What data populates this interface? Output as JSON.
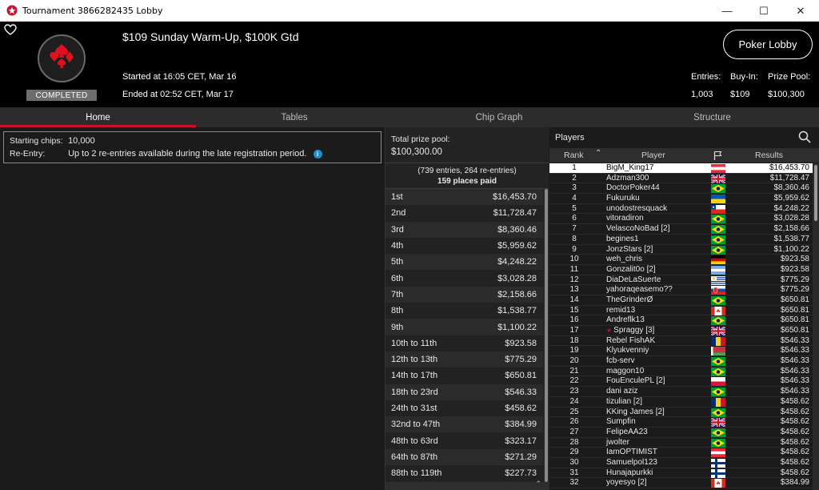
{
  "window": {
    "title": "Tournament 3866282435 Lobby",
    "minimize": "—",
    "maximize": "☐",
    "close": "✕"
  },
  "header": {
    "status_badge": "COMPLETED",
    "tournament_name": "$109 Sunday Warm-Up, $100K Gtd",
    "started": "Started at 16:05 CET, Mar 16",
    "ended": "Ended at 02:52 CET, Mar 17",
    "lobby_button": "Poker Lobby",
    "entries_label": "Entries:",
    "entries_value": "1,003",
    "buyin_label": "Buy-In:",
    "buyin_value": "$109",
    "prizepool_label": "Prize Pool:",
    "prizepool_value": "$100,300"
  },
  "tabs": [
    "Home",
    "Tables",
    "Chip Graph",
    "Structure"
  ],
  "info": {
    "starting_chips_label": "Starting chips:",
    "starting_chips_value": "10,000",
    "reentry_label": "Re-Entry:",
    "reentry_value": "Up to 2 re-entries available during the late registration period.",
    "info_icon": "i"
  },
  "prize": {
    "total_label": "Total prize pool:",
    "total_value": "$100,300.00",
    "entries_note": "(739 entries, 264 re-entries)",
    "places_paid": "159 places paid",
    "rows": [
      [
        "1st",
        "$16,453.70"
      ],
      [
        "2nd",
        "$11,728.47"
      ],
      [
        "3rd",
        "$8,360.46"
      ],
      [
        "4th",
        "$5,959.62"
      ],
      [
        "5th",
        "$4,248.22"
      ],
      [
        "6th",
        "$3,028.28"
      ],
      [
        "7th",
        "$2,158.66"
      ],
      [
        "8th",
        "$1,538.77"
      ],
      [
        "9th",
        "$1,100.22"
      ],
      [
        "10th to 11th",
        "$923.58"
      ],
      [
        "12th to 13th",
        "$775.29"
      ],
      [
        "14th to 17th",
        "$650.81"
      ],
      [
        "18th to 23rd",
        "$546.33"
      ],
      [
        "24th to 31st",
        "$458.62"
      ],
      [
        "32nd to 47th",
        "$384.99"
      ],
      [
        "48th to 63rd",
        "$323.17"
      ],
      [
        "64th to 87th",
        "$271.29"
      ],
      [
        "88th to 119th",
        "$227.73"
      ]
    ]
  },
  "players": {
    "title": "Players",
    "col_rank": "Rank",
    "col_player": "Player",
    "col_results": "Results",
    "rows": [
      [
        "1",
        "BigM_King17",
        "$16,453.70",
        "at"
      ],
      [
        "2",
        "Adzman300",
        "$11,728.47",
        "gb"
      ],
      [
        "3",
        "DoctorPoker44",
        "$8,360.46",
        "br"
      ],
      [
        "4",
        "Fukuruku",
        "$5,959.62",
        "ua"
      ],
      [
        "5",
        "unodostresquack",
        "$4,248.22",
        "cl"
      ],
      [
        "6",
        "vitoradiron",
        "$3,028.28",
        "br"
      ],
      [
        "7",
        "VelascoNoBad [2]",
        "$2,158.66",
        "br"
      ],
      [
        "8",
        "begines1",
        "$1,538.77",
        "br"
      ],
      [
        "9",
        "JonzStars [2]",
        "$1,100.22",
        "br"
      ],
      [
        "10",
        "weh_chris",
        "$923.58",
        "de"
      ],
      [
        "11",
        "Gonzalit0o [2]",
        "$923.58",
        "ar"
      ],
      [
        "12",
        "DiaDeLaSuerte",
        "$775.29",
        "uy"
      ],
      [
        "13",
        "yahoraqeasemo??",
        "$775.29",
        "sk"
      ],
      [
        "14",
        "TheGrinderØ",
        "$650.81",
        "br"
      ],
      [
        "15",
        "remid13",
        "$650.81",
        "ca"
      ],
      [
        "16",
        "Andreflk13",
        "$650.81",
        "br"
      ],
      [
        "17",
        "Spraggy [3]",
        "$650.81",
        "gb"
      ],
      [
        "18",
        "Rebel FishAK",
        "$546.33",
        "ro"
      ],
      [
        "19",
        "Klyukvenniy",
        "$546.33",
        "by"
      ],
      [
        "20",
        "fcb-serv",
        "$546.33",
        "br"
      ],
      [
        "21",
        "maggon10",
        "$546.33",
        "br"
      ],
      [
        "22",
        "FouEnculePL [2]",
        "$546.33",
        "pl"
      ],
      [
        "23",
        "dani aziz",
        "$546.33",
        "br"
      ],
      [
        "24",
        "tizulian [2]",
        "$458.62",
        "ro"
      ],
      [
        "25",
        "KKing James [2]",
        "$458.62",
        "br"
      ],
      [
        "26",
        "Sumpfin",
        "$458.62",
        "gb"
      ],
      [
        "27",
        "FelipeAA23",
        "$458.62",
        "br"
      ],
      [
        "28",
        "jwolter",
        "$458.62",
        "br"
      ],
      [
        "29",
        "IamOPTIMIST",
        "$458.62",
        "at"
      ],
      [
        "30",
        "Samuelpol123",
        "$458.62",
        "fi"
      ],
      [
        "31",
        "Hunajapurkki",
        "$458.62",
        "fi"
      ],
      [
        "32",
        "yoyesyo [2]",
        "$384.99",
        "ca"
      ]
    ]
  },
  "colors": {
    "accent": "#c8102e",
    "header_bg": "#000000",
    "panel_bg": "#1b1b1b"
  }
}
